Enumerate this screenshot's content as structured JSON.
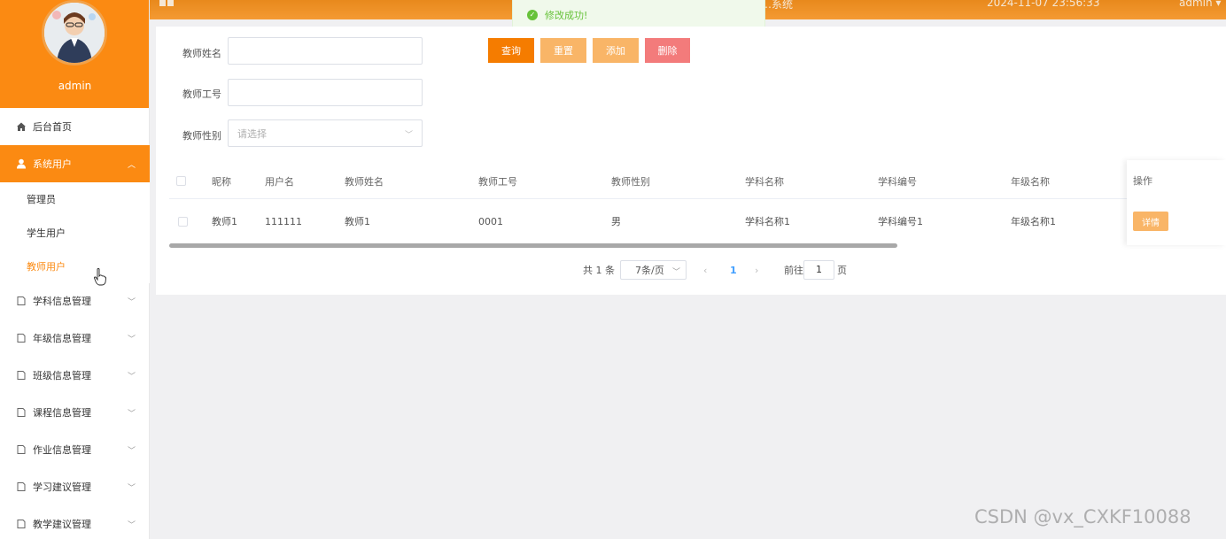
{
  "profile": {
    "username": "admin"
  },
  "topbar": {
    "system_title": "…系统",
    "datetime": "2024-11-07 23:56:33",
    "user_menu": "admin ▾"
  },
  "toast": {
    "message": "修改成功!"
  },
  "sidebar": {
    "home": "后台首页",
    "system_users": "系统用户",
    "sub_items": [
      "管理员",
      "学生用户",
      "教师用户"
    ],
    "modules": [
      "学科信息管理",
      "年级信息管理",
      "班级信息管理",
      "课程信息管理",
      "作业信息管理",
      "学习建议管理",
      "教学建议管理"
    ]
  },
  "search_form": {
    "teacher_name_label": "教师姓名",
    "teacher_no_label": "教师工号",
    "teacher_gender_label": "教师性别",
    "gender_placeholder": "请选择"
  },
  "buttons": {
    "query": "查询",
    "reset": "重置",
    "add": "添加",
    "delete": "删除"
  },
  "button_colors": {
    "query": "#f57c00",
    "reset": "#f9b567",
    "add": "#f9b567",
    "delete": "#f37b7b"
  },
  "table": {
    "headers": [
      "昵称",
      "用户名",
      "教师姓名",
      "教师工号",
      "教师性别",
      "学科名称",
      "学科编号",
      "年级名称",
      "操作"
    ],
    "rows": [
      {
        "nickname": "教师1",
        "username": "111111",
        "teacher_name": "教师1",
        "teacher_no": "0001",
        "gender": "男",
        "subject_name": "学科名称1",
        "subject_no": "学科编号1",
        "grade_name": "年级名称1",
        "action": "详情"
      }
    ]
  },
  "pagination": {
    "total": "共 1 条",
    "page_size": "7条/页",
    "current_page": "1",
    "goto_label": "前往",
    "goto_value": "1",
    "page_suffix": "页"
  },
  "watermark": "CSDN @vx_CXKF10088",
  "colors": {
    "accent": "#fb8a12",
    "success": "#67c23a",
    "link": "#409eff"
  }
}
